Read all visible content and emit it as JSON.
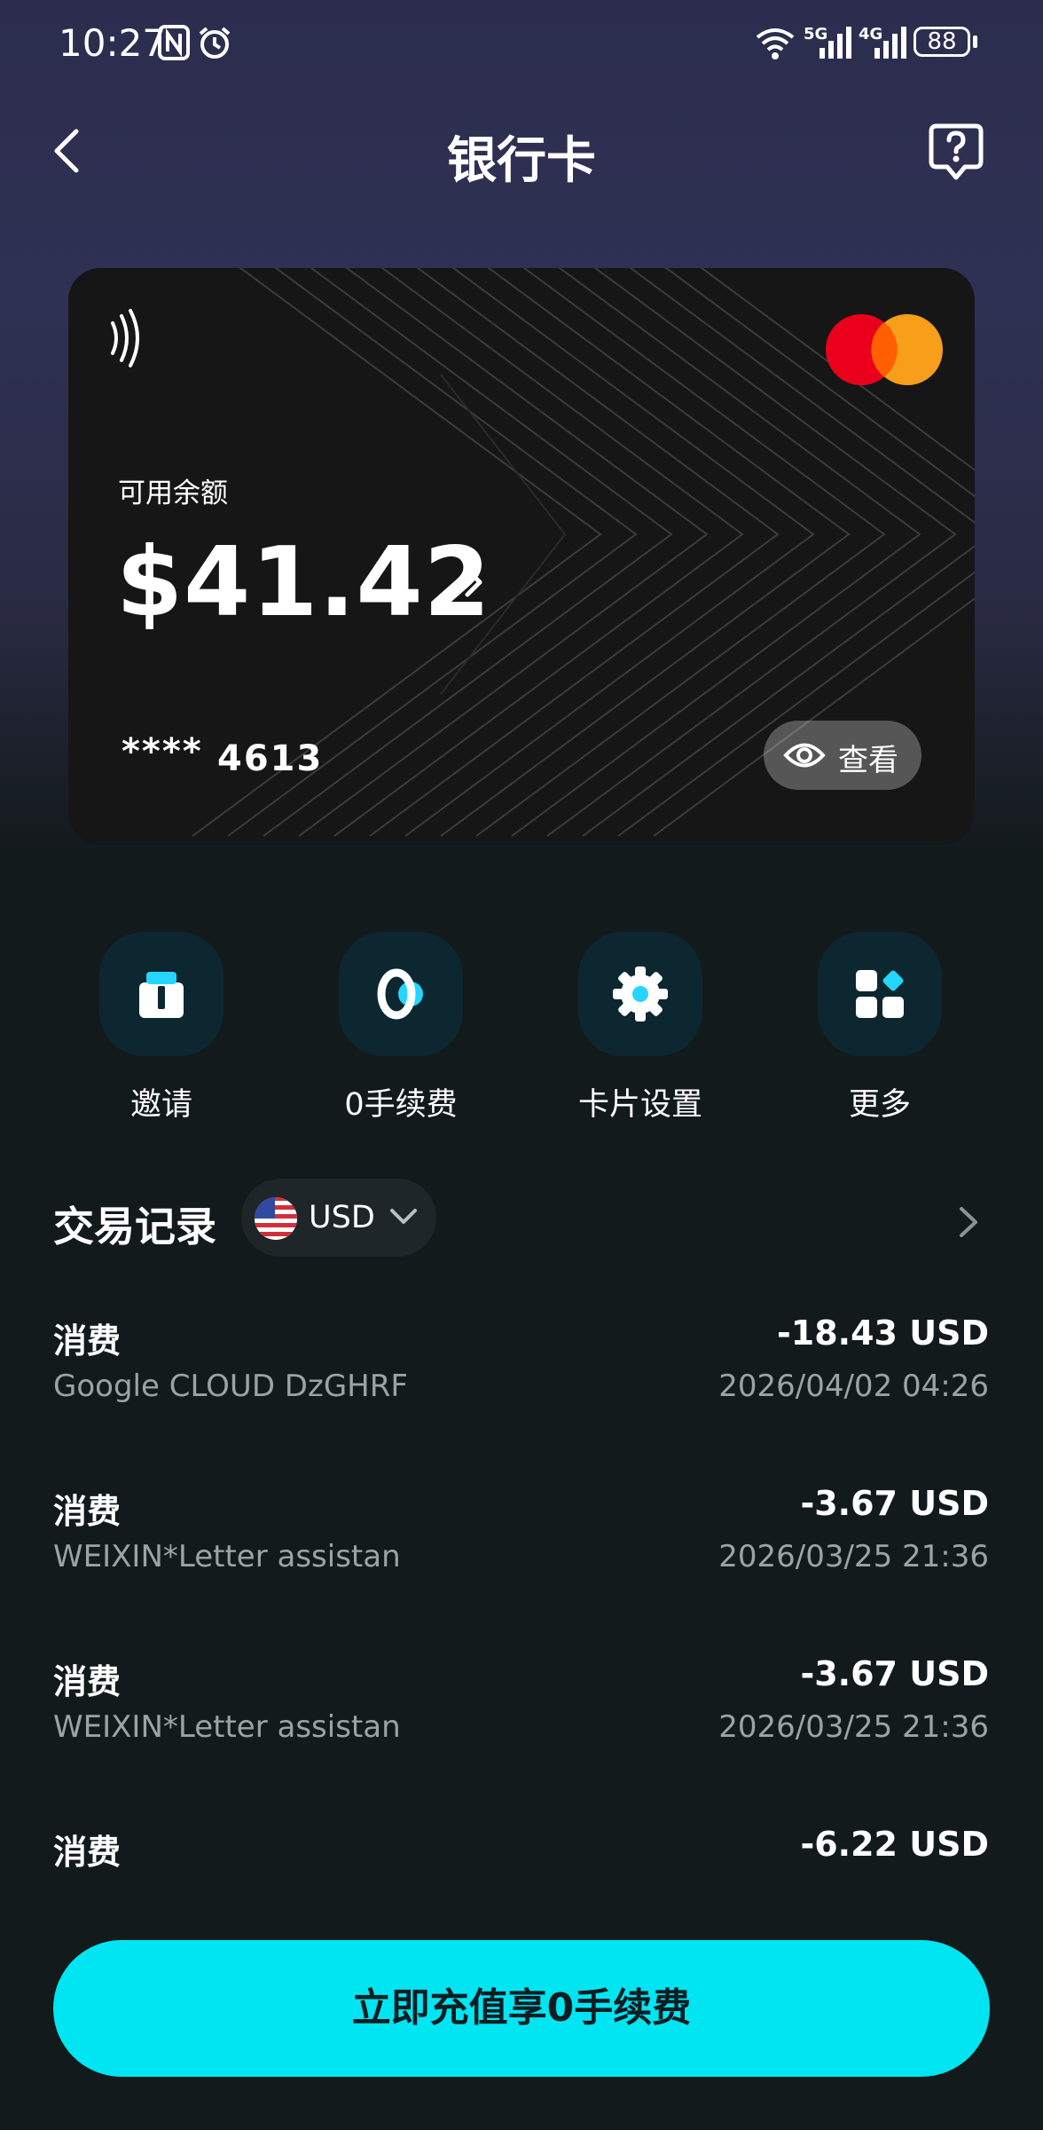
{
  "status_bar": {
    "time": "10:27",
    "battery": "88",
    "network_5g": "5G",
    "network_4g": "4G"
  },
  "nav": {
    "title": "银行卡"
  },
  "card": {
    "balance_label": "可用余额",
    "balance": "$41.42",
    "masked": "****",
    "last4": "4613",
    "view_label": "查看"
  },
  "quick_actions": [
    {
      "label": "邀请",
      "icon": "gift-icon"
    },
    {
      "label": "0手续费",
      "icon": "zero-fee-icon"
    },
    {
      "label": "卡片设置",
      "icon": "gear-icon"
    },
    {
      "label": "更多",
      "icon": "grid-icon"
    }
  ],
  "transactions": {
    "title": "交易记录",
    "currency": "USD",
    "items": [
      {
        "type": "消费",
        "amount": "-18.43 USD",
        "desc": "Google CLOUD DzGHRF",
        "date": "2026/04/02 04:26"
      },
      {
        "type": "消费",
        "amount": "-3.67 USD",
        "desc": "WEIXIN*Letter assistan",
        "date": "2026/03/25 21:36"
      },
      {
        "type": "消费",
        "amount": "-3.67 USD",
        "desc": "WEIXIN*Letter assistan",
        "date": "2026/03/25 21:36"
      },
      {
        "type": "消费",
        "amount": "-6.22 USD",
        "desc": "",
        "date": ""
      }
    ]
  },
  "cta": {
    "label": "立即充值享0手续费"
  },
  "colors": {
    "accent": "#00e5f2",
    "background": "#131a1c",
    "icon_bg": "#0c2730"
  }
}
